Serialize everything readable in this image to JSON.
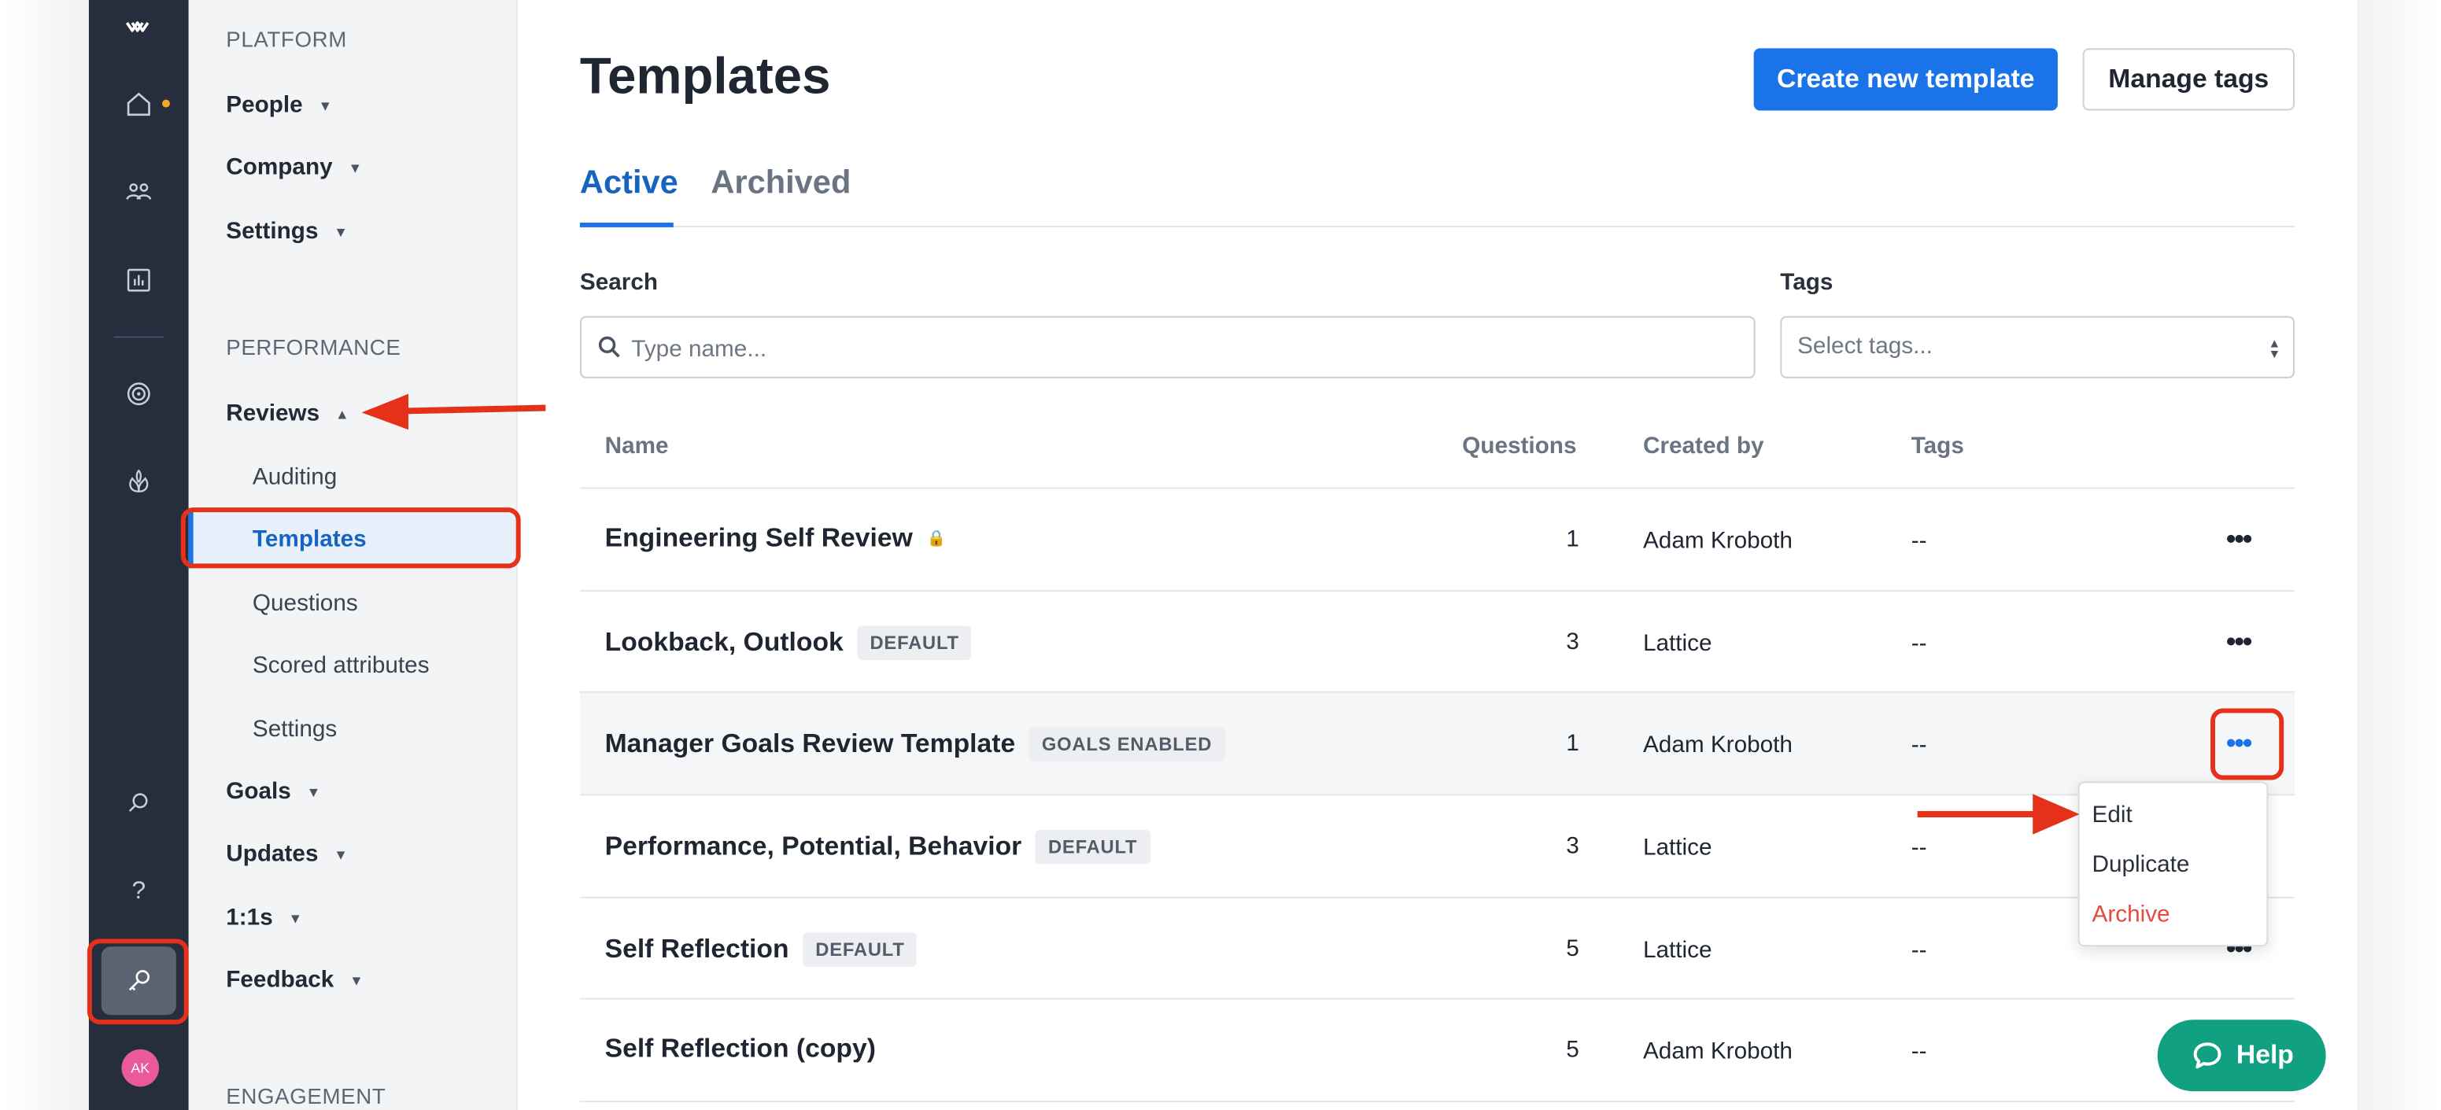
{
  "colors": {
    "brand_blue": "#1a73e8",
    "annotation_red": "#e5301a",
    "help_green": "#12a083",
    "archive_red": "#e54b3c",
    "rail_dark": "#262d3d"
  },
  "rail": {
    "icons": [
      "lattice-logo-icon",
      "home-icon",
      "people-icon",
      "analytics-icon",
      "target-icon",
      "growth-icon",
      "search-icon",
      "help-icon",
      "admin-key-icon"
    ],
    "help_glyph": "?",
    "avatar": "AK"
  },
  "sidebar": {
    "platform_header": "PLATFORM",
    "platform_items": [
      {
        "label": "People"
      },
      {
        "label": "Company"
      },
      {
        "label": "Settings"
      }
    ],
    "performance_header": "PERFORMANCE",
    "reviews": {
      "label": "Reviews",
      "sub": [
        "Auditing",
        "Templates",
        "Questions",
        "Scored attributes",
        "Settings"
      ]
    },
    "performance_items": [
      {
        "label": "Goals"
      },
      {
        "label": "Updates"
      },
      {
        "label": "1:1s"
      },
      {
        "label": "Feedback"
      }
    ],
    "engagement_header": "ENGAGEMENT"
  },
  "header": {
    "title": "Templates",
    "create_label": "Create new template",
    "tags_label": "Manage tags"
  },
  "tabs": [
    {
      "label": "Active",
      "selected": true
    },
    {
      "label": "Archived",
      "selected": false
    }
  ],
  "filters": {
    "search_label": "Search",
    "search_placeholder": "Type name...",
    "tags_label": "Tags",
    "tags_placeholder": "Select tags..."
  },
  "table": {
    "headers": [
      "Name",
      "Questions",
      "Created by",
      "Tags"
    ],
    "rows": [
      {
        "name": "Engineering Self Review",
        "badge": "",
        "questions": "1",
        "created_by": "Adam Kroboth",
        "tags": "--",
        "locked": true
      },
      {
        "name": "Lookback, Outlook",
        "badge": "DEFAULT",
        "questions": "3",
        "created_by": "Lattice",
        "tags": "--"
      },
      {
        "name": "Manager Goals Review Template",
        "badge": "GOALS ENABLED",
        "questions": "1",
        "created_by": "Adam Kroboth",
        "tags": "--",
        "menu_open": true
      },
      {
        "name": "Performance, Potential, Behavior",
        "badge": "DEFAULT",
        "questions": "3",
        "created_by": "Lattice",
        "tags": "--"
      },
      {
        "name": "Self Reflection",
        "badge": "DEFAULT",
        "questions": "5",
        "created_by": "Lattice",
        "tags": "--"
      },
      {
        "name": "Self Reflection (copy)",
        "badge": "",
        "questions": "5",
        "created_by": "Adam Kroboth",
        "tags": "--"
      }
    ],
    "more_glyph": "•••"
  },
  "row_menu": {
    "items": [
      "Edit",
      "Duplicate",
      "Archive"
    ]
  },
  "help_button": {
    "label": "Help"
  }
}
